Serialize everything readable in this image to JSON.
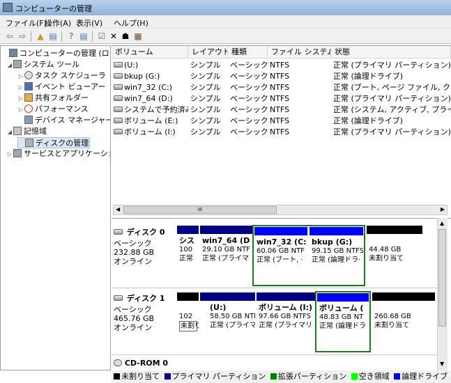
{
  "window": {
    "title": "コンピューターの管理"
  },
  "menu": [
    "ファイル(F)",
    "操作(A)",
    "表示(V)",
    "ヘルプ(H)"
  ],
  "tree": [
    {
      "label": "コンピューターの管理 (ローカ",
      "icon": "computer-icon"
    },
    {
      "label": "システム ツール",
      "icon": "tools-icon"
    },
    {
      "label": "タスク スケジューラ",
      "icon": "clock-icon"
    },
    {
      "label": "イベント ビューアー",
      "icon": "event-viewer-icon"
    },
    {
      "label": "共有フォルダー",
      "icon": "shared-folder-icon"
    },
    {
      "label": "パフォーマンス",
      "icon": "performance-icon"
    },
    {
      "label": "デバイス マネージャー",
      "icon": "device-manager-icon"
    },
    {
      "label": "記憶域",
      "icon": "storage-icon"
    },
    {
      "label": "ディスクの管理",
      "icon": "disk-management-icon"
    },
    {
      "label": "サービスとアプリケーショ",
      "icon": "services-icon"
    }
  ],
  "columns": [
    "ボリューム",
    "レイアウト",
    "種類",
    "ファイル システム",
    "状態"
  ],
  "volumes": [
    {
      "name": "(U:)",
      "layout": "シンプル",
      "type": "ベーシック",
      "fs": "NTFS",
      "status": "正常 (プライマリ パーティション)"
    },
    {
      "name": "bkup (G:)",
      "layout": "シンプル",
      "type": "ベーシック",
      "fs": "NTFS",
      "status": "正常 (論理ドライブ)"
    },
    {
      "name": "win7_32 (C:)",
      "layout": "シンプル",
      "type": "ベーシック",
      "fs": "NTFS",
      "status": "正常 (ブート, ページ ファイル, クラ"
    },
    {
      "name": "win7_64 (D:)",
      "layout": "シンプル",
      "type": "ベーシック",
      "fs": "NTFS",
      "status": "正常 (プライマリ パーティション)"
    },
    {
      "name": "システムで予約済み",
      "layout": "シンプル",
      "type": "ベーシック",
      "fs": "NTFS",
      "status": "正常 (システム, アクティブ, プライマ"
    },
    {
      "name": "ボリューム (E:)",
      "layout": "シンプル",
      "type": "ベーシック",
      "fs": "NTFS",
      "status": "正常 (論理ドライブ)"
    },
    {
      "name": "ボリューム (I:)",
      "layout": "シンプル",
      "type": "ベーシック",
      "fs": "NTFS",
      "status": "正常 (プライマリ パーティション)"
    }
  ],
  "scroll_mark": "III",
  "disks": [
    {
      "name": "ディスク 0",
      "type": "ベーシック",
      "size": "232.88 GB",
      "state": "オンライン",
      "partitions": [
        {
          "name": "シス",
          "size": "100",
          "status": "正常",
          "color": "#000080"
        },
        {
          "name": "win7_64 (D",
          "size": "29.10 GB NTF",
          "status": "正常 (プライマ",
          "color": "#000080"
        },
        {
          "name": "win7_32 (C:",
          "size": "60.06 GB NTF",
          "status": "正常 (ブート, ·",
          "color": "#0000ff"
        },
        {
          "name": "bkup (G:)",
          "size": "99.15 GB NTFS",
          "status": "正常 (論理ドラ·",
          "color": "#0000ff"
        },
        {
          "name": "",
          "size": "44.48 GB",
          "status": "未割り当て",
          "color": "#000000"
        }
      ]
    },
    {
      "name": "ディスク 1",
      "type": "ベーシック",
      "size": "465.76 GB",
      "state": "オンライン",
      "partitions": [
        {
          "name": "",
          "size": "102",
          "status": "未割り当て",
          "color": "#000000"
        },
        {
          "name": "(U:)",
          "size": "58.50 GB NTFS",
          "status": "正常 (プライマリ",
          "color": "#000080"
        },
        {
          "name": "ボリューム (I:)",
          "size": "97.66 GB NTFS",
          "status": "正常 (プライマリ",
          "color": "#000080"
        },
        {
          "name": "ボリューム (",
          "size": "48.83 GB NT",
          "status": "正常 (論理ドラ",
          "color": "#0000ff"
        },
        {
          "name": "",
          "size": "260.68 GB",
          "status": "未割り当て",
          "color": "#000000"
        }
      ]
    },
    {
      "name": "CD-ROM 0"
    }
  ],
  "legend": [
    {
      "label": "未割り当て",
      "color": "#000000"
    },
    {
      "label": "プライマリ パーティション",
      "color": "#000080"
    },
    {
      "label": "拡張パーティション",
      "color": "#008000"
    },
    {
      "label": "空き領域",
      "color": "#00ff00"
    },
    {
      "label": "論理ドライブ",
      "color": "#0000ff"
    }
  ]
}
